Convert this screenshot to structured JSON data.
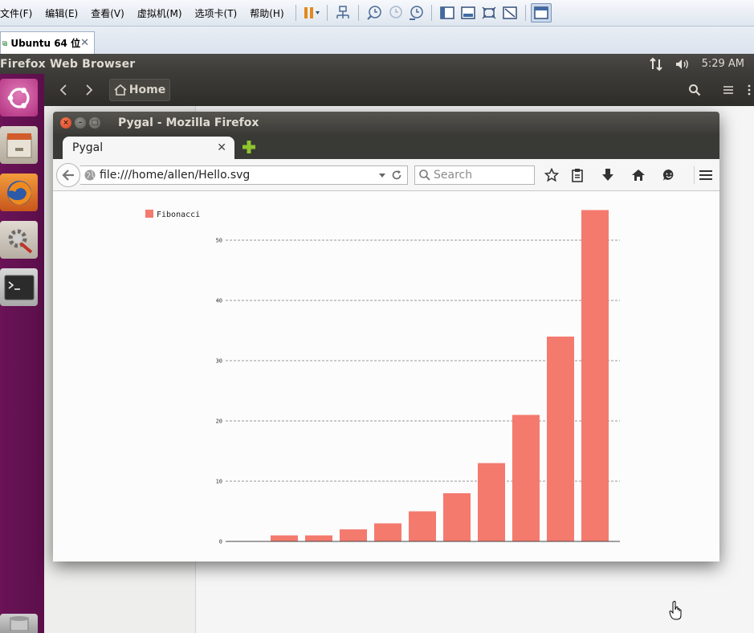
{
  "vmware": {
    "menu": [
      "文件(F)",
      "编辑(E)",
      "查看(V)",
      "虚拟机(M)",
      "选项卡(T)",
      "帮助(H)"
    ],
    "tab_label": "Ubuntu 64 位",
    "accent": "#dfe6ef"
  },
  "ubuntu_panel": {
    "title": "Firefox Web Browser",
    "clock": "5:29 AM"
  },
  "nautilus": {
    "home_label": "Home"
  },
  "firefox": {
    "window_title": "Pygal - Mozilla Firefox",
    "tab_title": "Pygal",
    "url": "file:///home/allen/Hello.svg",
    "search_placeholder": "Search"
  },
  "chart_data": {
    "type": "bar",
    "series": [
      {
        "name": "Fibonacci",
        "color": "#f47a6e",
        "values": [
          0,
          1,
          1,
          2,
          3,
          5,
          8,
          13,
          21,
          34,
          55
        ]
      }
    ],
    "y_ticks": [
      0,
      10,
      20,
      30,
      40,
      50
    ],
    "ylim": [
      0,
      55
    ],
    "grid": true,
    "legend": "top-left"
  }
}
